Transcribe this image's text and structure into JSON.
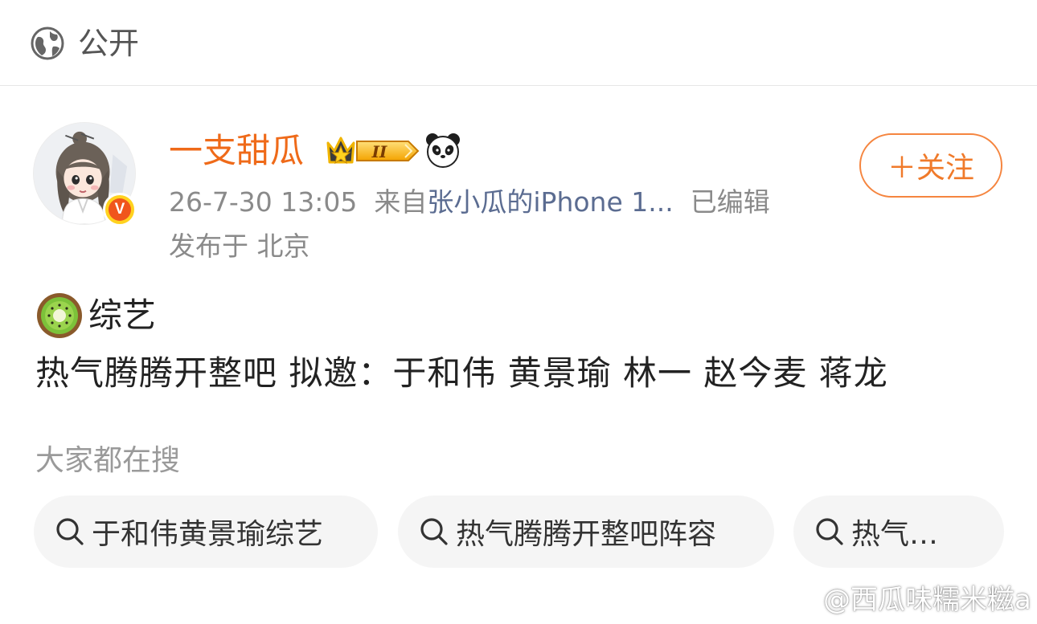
{
  "visibility": {
    "icon": "globe-icon",
    "label": "公开"
  },
  "post": {
    "username": "一支甜瓜",
    "username_color": "#ef6a19",
    "badge_level": "II",
    "follow_label": "＋关注",
    "date_time": "26-7-30 13:05",
    "source_prefix": "来自",
    "device": "张小瓜的iPhone 1...",
    "edited_label": "已编辑",
    "location": "发布于 北京",
    "topic_label": "综艺",
    "content": "热气腾腾开整吧 拟邀：于和伟 黄景瑜 林一 赵今麦 蒋龙"
  },
  "search_section": {
    "title": "大家都在搜",
    "chips": [
      {
        "label": "于和伟黄景瑜综艺"
      },
      {
        "label": "热气腾腾开整吧阵容"
      },
      {
        "label": "热气…"
      }
    ]
  },
  "watermark": "@西瓜味糯米糍a",
  "colors": {
    "accent": "#ef6a19",
    "link": "#5b6c91",
    "chip_bg": "#f5f5f5"
  }
}
